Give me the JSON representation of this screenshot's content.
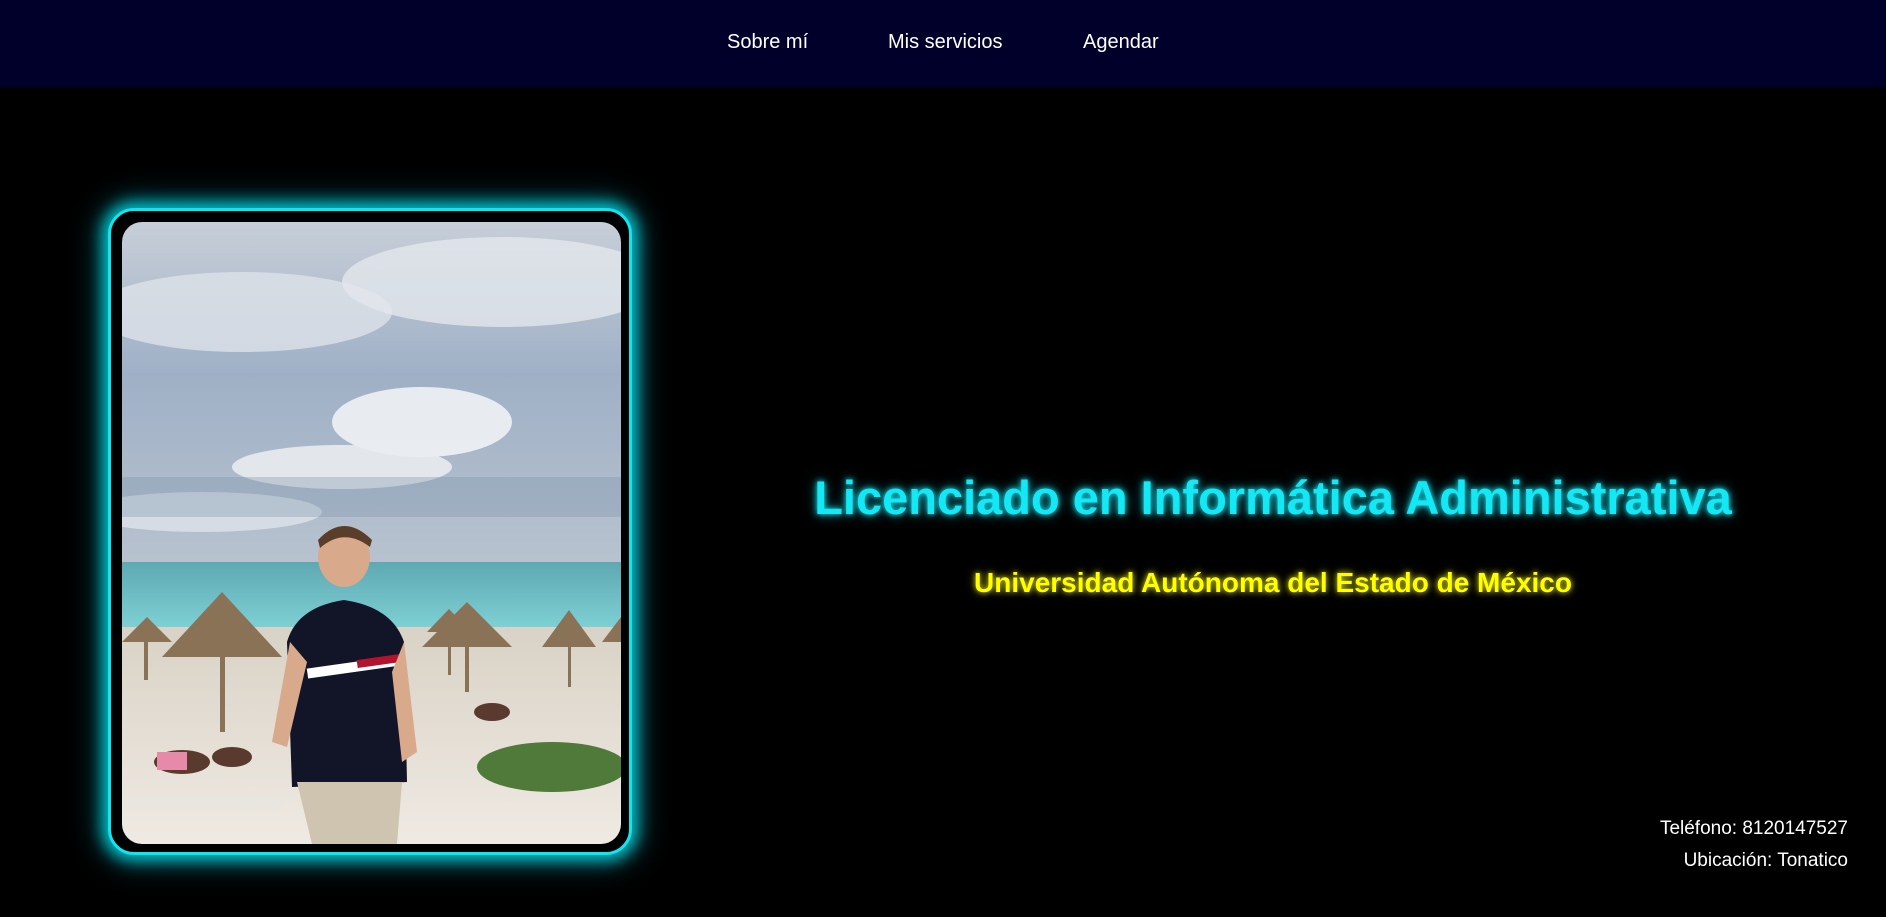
{
  "nav": {
    "items": [
      {
        "label": "Sobre mí"
      },
      {
        "label": "Mis servicios"
      },
      {
        "label": "Agendar"
      }
    ]
  },
  "hero": {
    "title": "Licenciado en Informática Administrativa",
    "subtitle": "Universidad Autónoma del Estado de México"
  },
  "contact": {
    "phone": "Teléfono: 8120147527",
    "location": "Ubicación: Tonatico"
  },
  "colors": {
    "navbar_bg": "#00002a",
    "page_bg": "#000000",
    "title": "#14e8f5",
    "subtitle": "#ffff00",
    "frame_glow": "#13e4ee"
  }
}
